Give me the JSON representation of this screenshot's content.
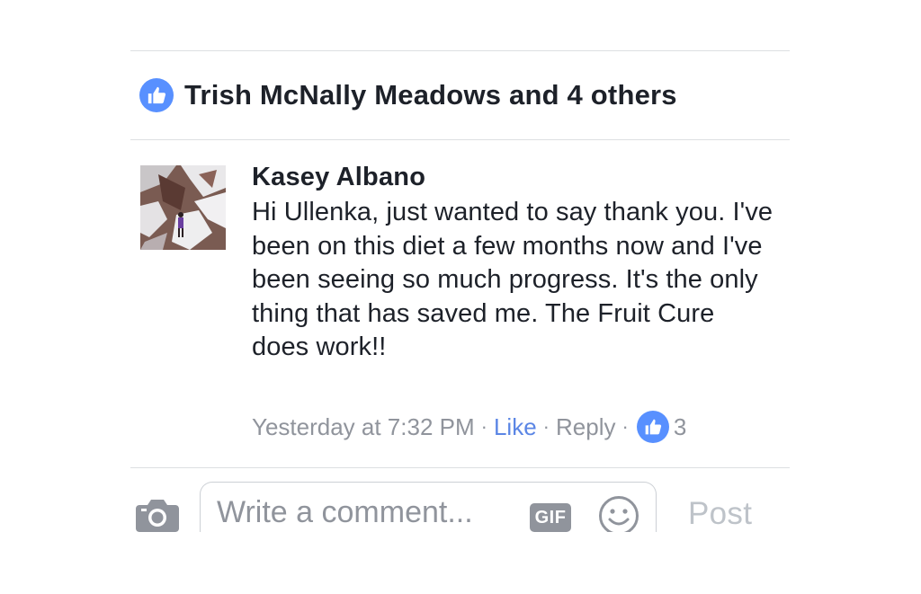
{
  "likes_summary": {
    "text": "Trish McNally Meadows and 4 others",
    "icon": "thumbs-up-icon",
    "badge_color": "#5890ff"
  },
  "comment": {
    "author": "Kasey Albano",
    "avatar_icon": "avatar-photo",
    "text": "Hi Ullenka, just wanted to say thank you. I've been on this diet a few months now and I've been seeing so much progress. It's the only thing that has saved me. The Fruit Cure does work!!",
    "timestamp": "Yesterday at 7:32 PM",
    "separator": "·",
    "like_label": "Like",
    "reply_label": "Reply",
    "reaction_count": "3",
    "link_color": "#5b86e5"
  },
  "composer": {
    "placeholder": "Write a comment...",
    "gif_label": "GIF",
    "post_label": "Post",
    "camera_icon": "camera-icon",
    "emoji_icon": "smiley-icon"
  }
}
